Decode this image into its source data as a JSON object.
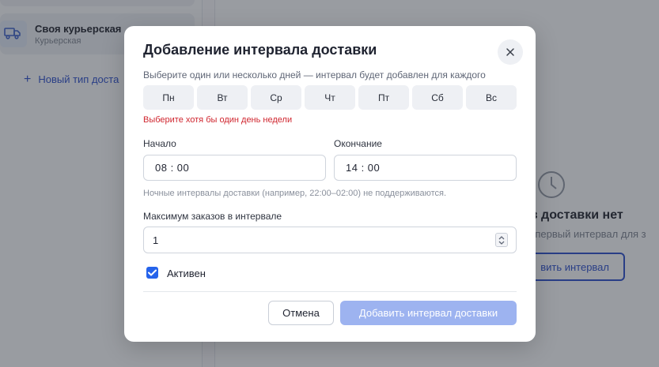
{
  "background": {
    "courier": {
      "name": "Своя курьерская",
      "subtitle": "Курьерская"
    },
    "new_type_label": "Новый тип доста",
    "empty_state": {
      "title": "ов доставки нет",
      "text": "ть первый интервал для з",
      "button_label": "вить интервал"
    }
  },
  "modal": {
    "title": "Добавление интервала доставки",
    "close_icon": "close-icon",
    "days_hint": "Выберите один или несколько дней — интервал будет добавлен для каждого",
    "days": [
      "Пн",
      "Вт",
      "Ср",
      "Чт",
      "Пт",
      "Сб",
      "Вс"
    ],
    "days_error": "Выберите хотя бы один день недели",
    "start": {
      "label": "Начало",
      "value": "08 : 00"
    },
    "end": {
      "label": "Окончание",
      "value": "14 : 00"
    },
    "night_note": "Ночные интервалы доставки (например, 22:00–02:00) не поддерживаются.",
    "max_orders": {
      "label": "Максимум заказов в интервале",
      "value": "1"
    },
    "active": {
      "label": "Активен",
      "checked": true
    },
    "cancel_label": "Отмена",
    "submit_label": "Добавить интервал доставки"
  },
  "colors": {
    "accent": "#2563eb",
    "error": "#d0262f",
    "submit_disabled": "#9db3f0"
  }
}
